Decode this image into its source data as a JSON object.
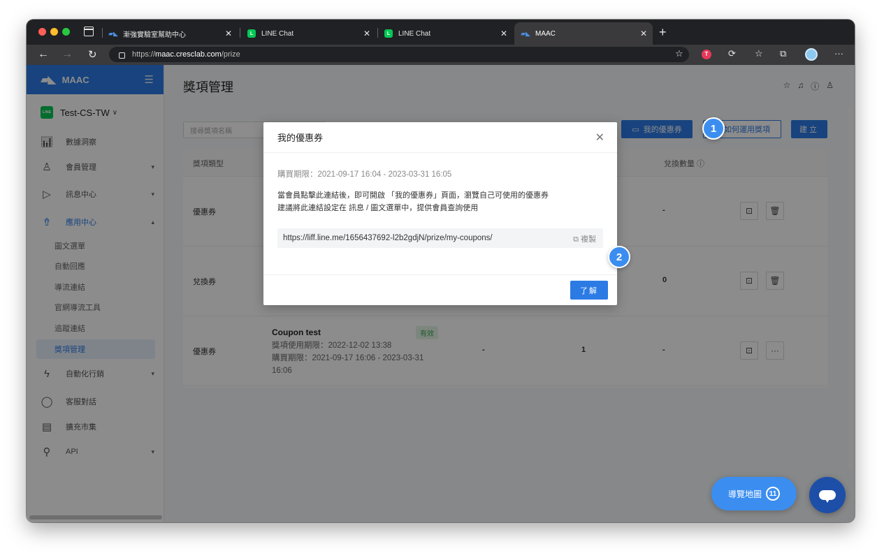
{
  "browser": {
    "tabs": [
      {
        "title": "漸強實驗室幫助中心",
        "favicon": "maac-icon"
      },
      {
        "title": "LINE Chat",
        "favicon": "line-icon"
      },
      {
        "title": "LINE Chat",
        "favicon": "line-icon"
      },
      {
        "title": "MAAC",
        "favicon": "maac-icon",
        "active": true
      }
    ],
    "url_scheme": "https://",
    "url_host": "maac.cresclab.com",
    "url_path": "/prize"
  },
  "sidebar": {
    "brand": "MAAC",
    "account": "Test-CS-TW",
    "items": [
      {
        "label": "數據洞察",
        "icon": "chart-icon"
      },
      {
        "label": "會員管理",
        "icon": "user-icon"
      },
      {
        "label": "訊息中心",
        "icon": "send-icon"
      },
      {
        "label": "應用中心",
        "icon": "rocket-icon"
      }
    ],
    "sub_items": [
      "圖文選單",
      "自動回應",
      "導流連結",
      "官網導流工具",
      "追蹤連結",
      "獎項管理"
    ],
    "items_after": [
      {
        "label": "自動化行銷",
        "icon": "lightning-icon"
      },
      {
        "label": "客服對話",
        "icon": "chat-icon"
      },
      {
        "label": "擴充市集",
        "icon": "store-icon"
      },
      {
        "label": "API",
        "icon": "plug-icon"
      }
    ]
  },
  "main": {
    "title": "獎項管理",
    "search_placeholder": "搜尋獎項名稱",
    "btn_my_coupon": "我的優惠券",
    "btn_howto": "如何運用獎項",
    "btn_create": "建立",
    "table": {
      "headers": [
        "獎項類型",
        "兌換數量"
      ],
      "rows": [
        {
          "type": "優惠券",
          "redeem": "-"
        },
        {
          "type": "兌換券",
          "redeem": "0"
        },
        {
          "type": "優惠券",
          "name": "Coupon test",
          "status": "有效",
          "use_period": "獎項使用期限：2022-12-02 13:38",
          "buy_period": "購買期限：2021-09-17 16:06 - 2023-03-31 16:06",
          "col_a": "-",
          "col_b": "1",
          "redeem": "-"
        }
      ]
    }
  },
  "modal": {
    "title": "我的優惠券",
    "period": "購買期限：2021-09-17 16:04 - 2023-03-31 16:05",
    "desc_line1": "當會員點擊此連結後，即可開啟 「我的優惠券」頁面，瀏覽自己可使用的優惠券",
    "desc_line2": "建議將此連結設定在 訊息 / 圖文選單中，提供會員查詢使用",
    "link": "https://liff.line.me/1656437692-l2b2gdjN/prize/my-coupons/",
    "copy_label": "複製",
    "ok_label": "了解"
  },
  "steps": [
    "1",
    "2"
  ],
  "floating": {
    "map_label": "導覽地圖",
    "map_count": "11"
  },
  "colors": {
    "primary": "#2c7be5",
    "line_green": "#06c755",
    "step_blue": "#3b8ef0"
  }
}
